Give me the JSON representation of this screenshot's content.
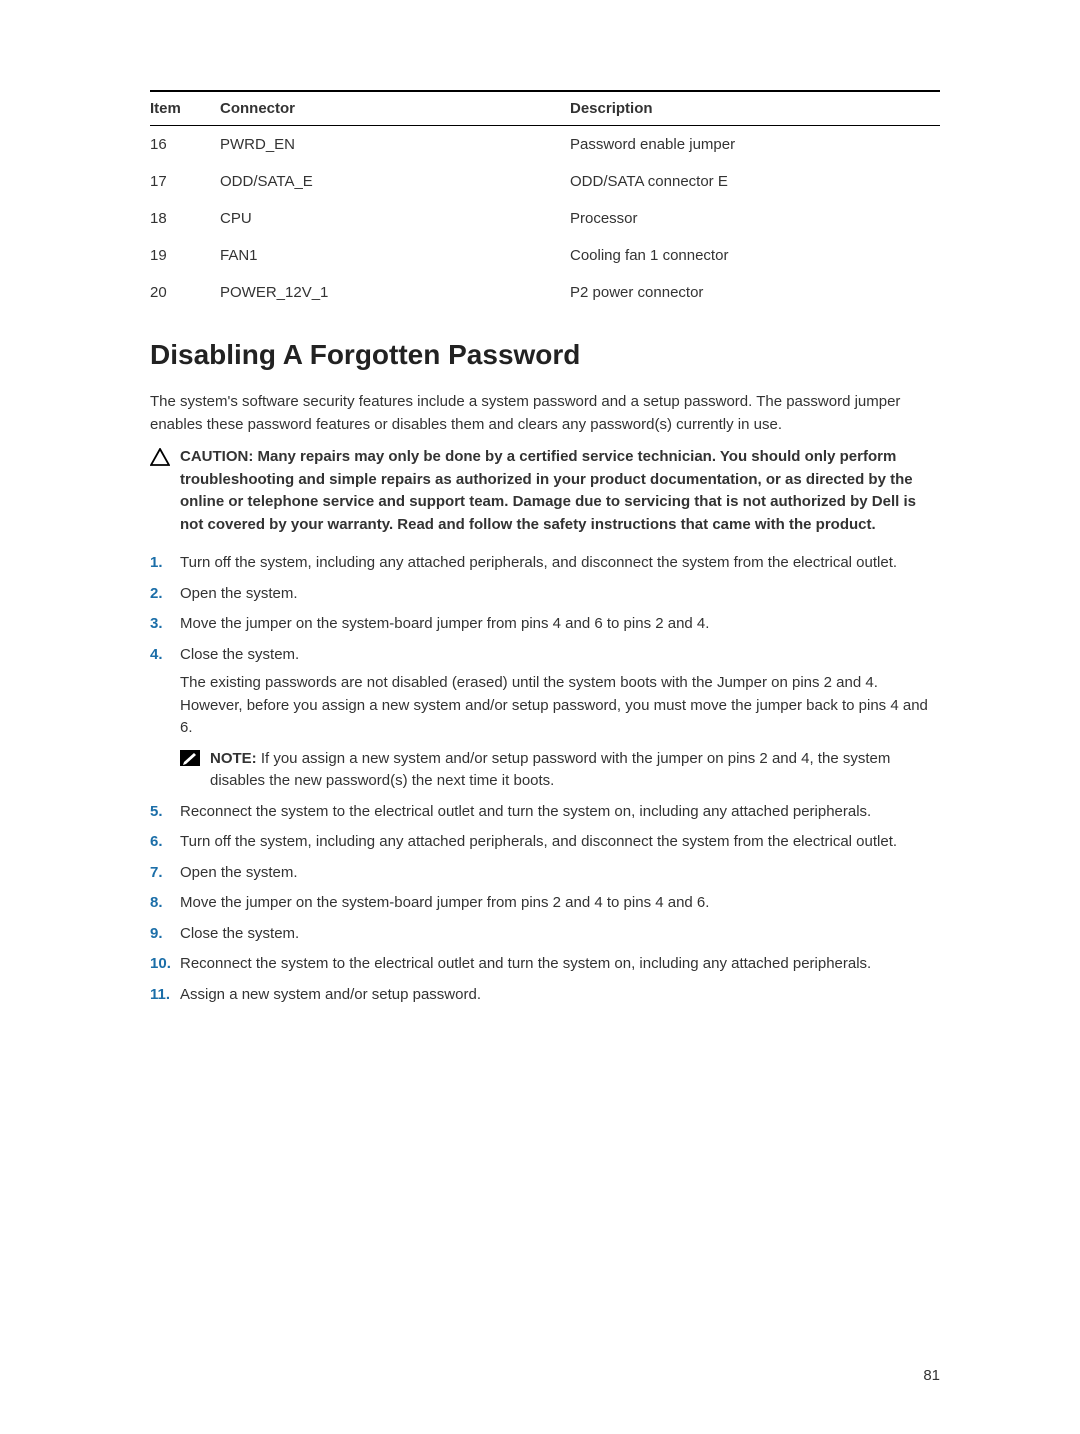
{
  "table": {
    "headers": [
      "Item",
      "Connector",
      "Description"
    ],
    "rows": [
      {
        "item": "16",
        "connector": "PWRD_EN",
        "description": "Password enable jumper"
      },
      {
        "item": "17",
        "connector": "ODD/SATA_E",
        "description": "ODD/SATA connector E"
      },
      {
        "item": "18",
        "connector": "CPU",
        "description": "Processor"
      },
      {
        "item": "19",
        "connector": "FAN1",
        "description": "Cooling fan 1 connector"
      },
      {
        "item": "20",
        "connector": "POWER_12V_1",
        "description": "P2 power connector"
      }
    ]
  },
  "heading": "Disabling A Forgotten Password",
  "intro": "The system's software security features include a system password and a setup password. The password jumper enables these password features or disables them and clears any password(s) currently in use.",
  "caution": "CAUTION: Many repairs may only be done by a certified service technician. You should only perform troubleshooting and simple repairs as authorized in your product documentation, or as directed by the online or telephone service and support team. Damage due to servicing that is not authorized by Dell is not covered by your warranty. Read and follow the safety instructions that came with the product.",
  "steps": [
    {
      "text": "Turn off the system, including any attached peripherals, and disconnect the system from the electrical outlet."
    },
    {
      "text": "Open the system."
    },
    {
      "text": "Move the jumper on the system-board jumper from pins 4 and 6 to pins 2 and 4."
    },
    {
      "text": "Close the system.",
      "subpara": "The existing passwords are not disabled (erased) until the system boots with the Jumper on pins 2 and 4. However, before you assign a new system and/or setup password, you must move the jumper back to pins 4 and 6.",
      "note_label": "NOTE:",
      "note": " If you assign a new system and/or setup password with the jumper on pins 2 and 4, the system disables the new password(s) the next time it boots."
    },
    {
      "text": "Reconnect the system to the electrical outlet and turn the system on, including any attached peripherals."
    },
    {
      "text": "Turn off the system, including any attached peripherals, and disconnect the system from the electrical outlet."
    },
    {
      "text": "Open the system."
    },
    {
      "text": "Move the jumper on the system-board jumper from pins 2 and 4 to pins 4 and 6."
    },
    {
      "text": "Close the system."
    },
    {
      "text": "Reconnect the system to the electrical outlet and turn the system on, including any attached peripherals."
    },
    {
      "text": "Assign a new system and/or setup password."
    }
  ],
  "page_number": "81"
}
